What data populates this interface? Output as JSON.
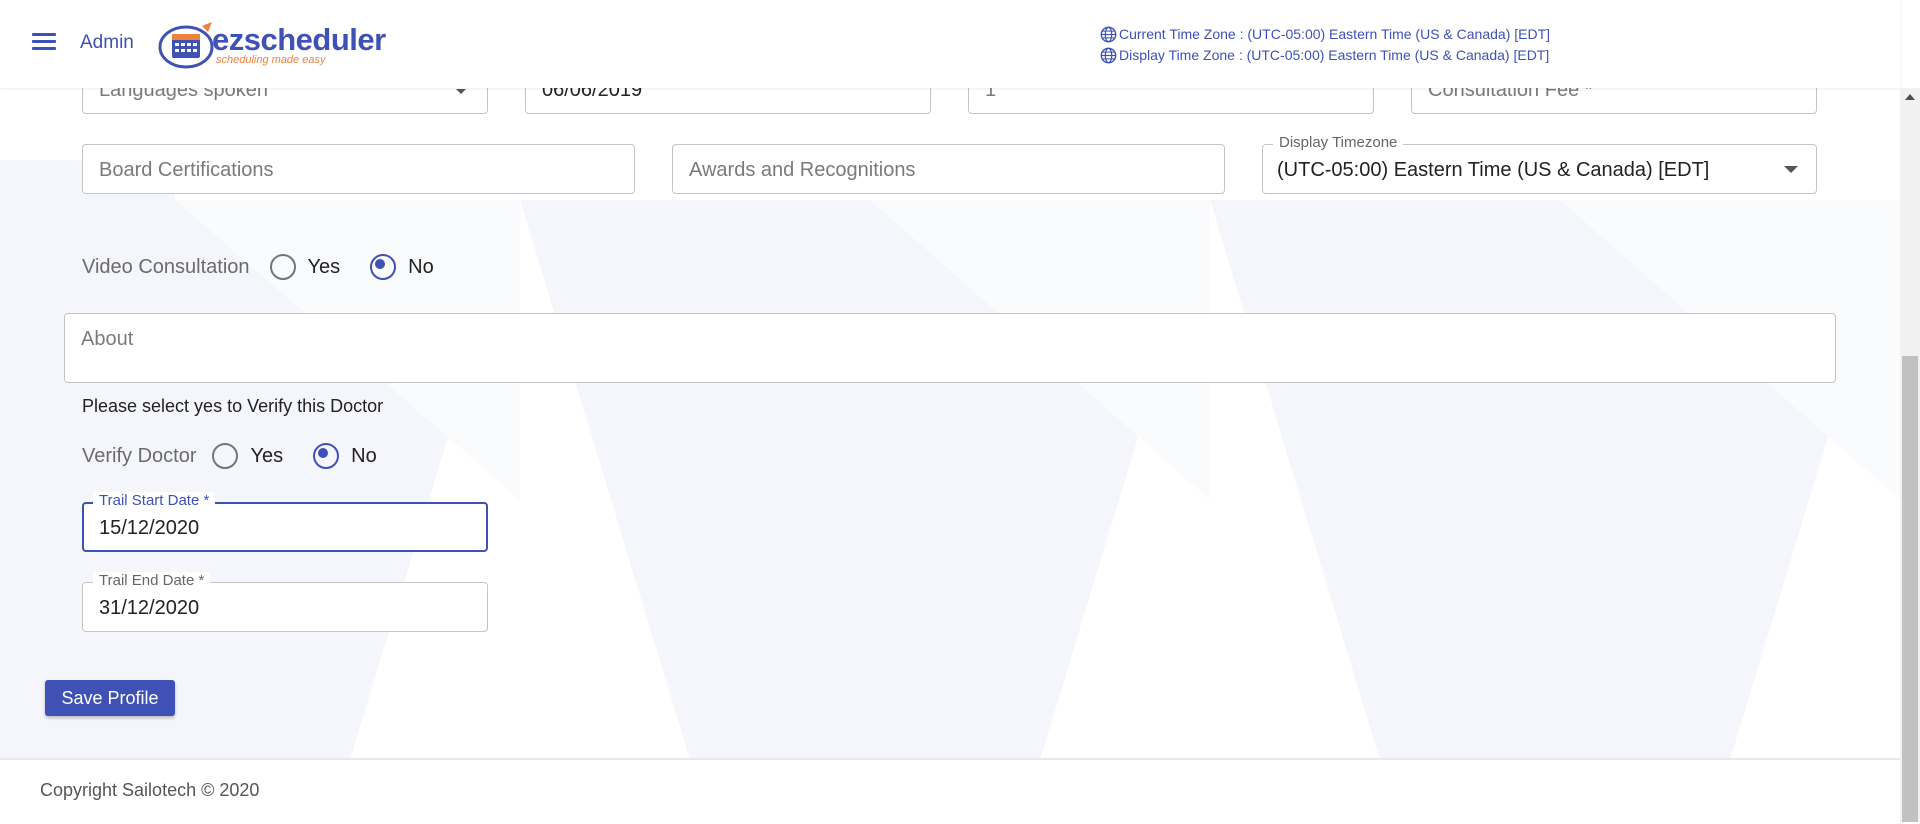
{
  "header": {
    "admin_label": "Admin",
    "logo_text": "ezscheduler",
    "logo_tagline": "scheduling made easy",
    "current_timezone": "Current Time Zone : (UTC-05:00) Eastern Time (US & Canada) [EDT]",
    "display_timezone": "Display Time Zone : (UTC-05:00) Eastern Time (US & Canada) [EDT]"
  },
  "form": {
    "languages_placeholder": "Languages spoken",
    "date_value": "06/06/2019",
    "number_value": "1",
    "consultation_fee_placeholder": "Consultation Fee *",
    "board_certifications_placeholder": "Board Certifications",
    "awards_placeholder": "Awards and Recognitions",
    "display_timezone_label": "Display Timezone",
    "display_timezone_value": "(UTC-05:00) Eastern Time (US & Canada) [EDT]",
    "video_consultation": {
      "label": "Video Consultation",
      "yes": "Yes",
      "no": "No",
      "selected": "No"
    },
    "about_placeholder": "About",
    "verify_note": "Please select yes to Verify this Doctor",
    "verify_doctor": {
      "label": "Verify Doctor",
      "yes": "Yes",
      "no": "No",
      "selected": "No"
    },
    "trail_start": {
      "label": "Trail Start Date *",
      "value": "15/12/2020"
    },
    "trail_end": {
      "label": "Trail End Date *",
      "value": "31/12/2020"
    },
    "save_button": "Save Profile"
  },
  "footer": {
    "copyright": "Copyright Sailotech © 2020"
  },
  "colors": {
    "primary": "#3f51b5",
    "accent": "#f0803c",
    "border": "#c4c4c4"
  }
}
